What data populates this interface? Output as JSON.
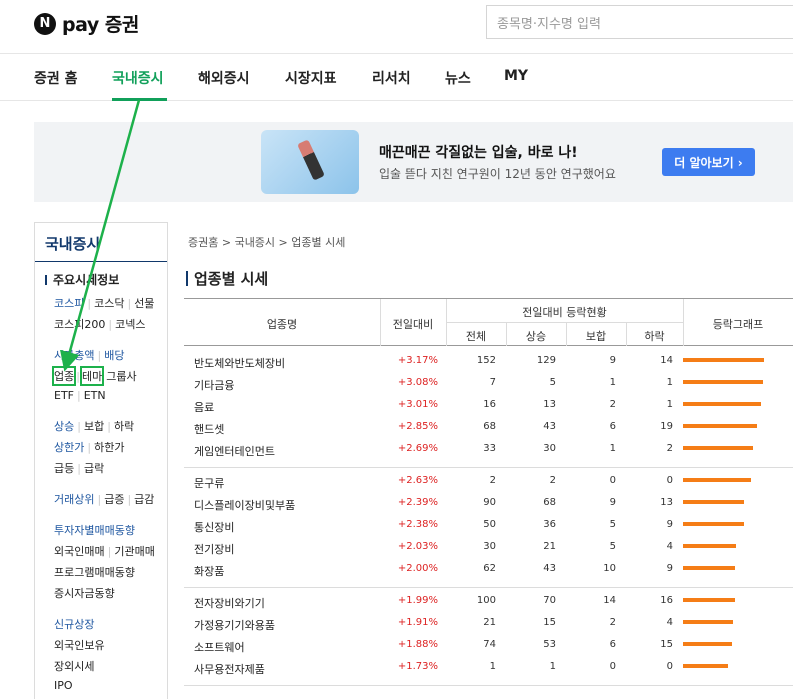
{
  "header": {
    "logo_mark": "N",
    "logo_text": "pay 증권",
    "search_placeholder": "종목명·지수명 입력"
  },
  "nav": {
    "items": [
      "증권 홈",
      "국내증시",
      "해외증시",
      "시장지표",
      "리서치",
      "뉴스",
      "MY"
    ],
    "active_index": 1
  },
  "banner": {
    "title": "매끈매끈 각질없는 입술, 바로 나!",
    "subtitle": "입술 뜯다 지친 연구원이 12년 동안 연구했어요",
    "button_label": "더 알아보기 ›"
  },
  "sidebar": {
    "title": "국내증시",
    "section": "주요시세정보",
    "rows": [
      [
        "코스피",
        "코스닥",
        "선물"
      ],
      [
        "코스피200",
        "코넥스"
      ],
      [
        "시가총액",
        "배당"
      ],
      [
        "업종",
        "테마",
        "그룹사"
      ],
      [
        "ETF",
        "ETN"
      ],
      [
        "상승",
        "보합",
        "하락"
      ],
      [
        "상한가",
        "하한가"
      ],
      [
        "급등",
        "급락"
      ],
      [
        "거래상위",
        "급증",
        "급감"
      ],
      [
        "투자자별매매동향"
      ],
      [
        "외국인매매",
        "기관매매"
      ],
      [
        "프로그램매매동향"
      ],
      [
        "증시자금동향"
      ],
      [
        "신규상장"
      ],
      [
        "외국인보유"
      ],
      [
        "장외시세"
      ],
      [
        "IPO"
      ]
    ]
  },
  "breadcrumb": "증권홈 > 국내증시 > 업종별 시세",
  "page_title": "업종별 시세",
  "table": {
    "headers": {
      "name": "업종명",
      "change": "전일대비",
      "status_group": "전일대비 등락현황",
      "total": "전체",
      "up": "상승",
      "flat": "보합",
      "down": "하락",
      "graph": "등락그래프"
    },
    "groups": [
      [
        {
          "name": "반도체와반도체장비",
          "rate": "+3.17%",
          "total": 152,
          "up": 129,
          "flat": 9,
          "down": 14
        },
        {
          "name": "기타금융",
          "rate": "+3.08%",
          "total": 7,
          "up": 5,
          "flat": 1,
          "down": 1
        },
        {
          "name": "음료",
          "rate": "+3.01%",
          "total": 16,
          "up": 13,
          "flat": 2,
          "down": 1
        },
        {
          "name": "핸드셋",
          "rate": "+2.85%",
          "total": 68,
          "up": 43,
          "flat": 6,
          "down": 19
        },
        {
          "name": "게임엔터테인먼트",
          "rate": "+2.69%",
          "total": 33,
          "up": 30,
          "flat": 1,
          "down": 2
        }
      ],
      [
        {
          "name": "문구류",
          "rate": "+2.63%",
          "total": 2,
          "up": 2,
          "flat": 0,
          "down": 0
        },
        {
          "name": "디스플레이장비및부품",
          "rate": "+2.39%",
          "total": 90,
          "up": 68,
          "flat": 9,
          "down": 13
        },
        {
          "name": "통신장비",
          "rate": "+2.38%",
          "total": 50,
          "up": 36,
          "flat": 5,
          "down": 9
        },
        {
          "name": "전기장비",
          "rate": "+2.03%",
          "total": 30,
          "up": 21,
          "flat": 5,
          "down": 4
        },
        {
          "name": "화장품",
          "rate": "+2.00%",
          "total": 62,
          "up": 43,
          "flat": 10,
          "down": 9
        }
      ],
      [
        {
          "name": "전자장비와기기",
          "rate": "+1.99%",
          "total": 100,
          "up": 70,
          "flat": 14,
          "down": 16
        },
        {
          "name": "가정용기기와용품",
          "rate": "+1.91%",
          "total": 21,
          "up": 15,
          "flat": 2,
          "down": 4
        },
        {
          "name": "소프트웨어",
          "rate": "+1.88%",
          "total": 74,
          "up": 53,
          "flat": 6,
          "down": 15
        },
        {
          "name": "사무용전자제품",
          "rate": "+1.73%",
          "total": 1,
          "up": 1,
          "flat": 0,
          "down": 0
        }
      ]
    ],
    "bar_fill": [
      0.84,
      0.83,
      0.81,
      0.77,
      0.73,
      0.71,
      0.64,
      0.64,
      0.55,
      0.54,
      0.54,
      0.52,
      0.51,
      0.47
    ]
  },
  "colors": {
    "accent_green": "#11a05a",
    "rate_red": "#dd2222",
    "bar_orange": "#f57d16",
    "navy": "#11386b",
    "annotation_green": "#1db14b"
  }
}
